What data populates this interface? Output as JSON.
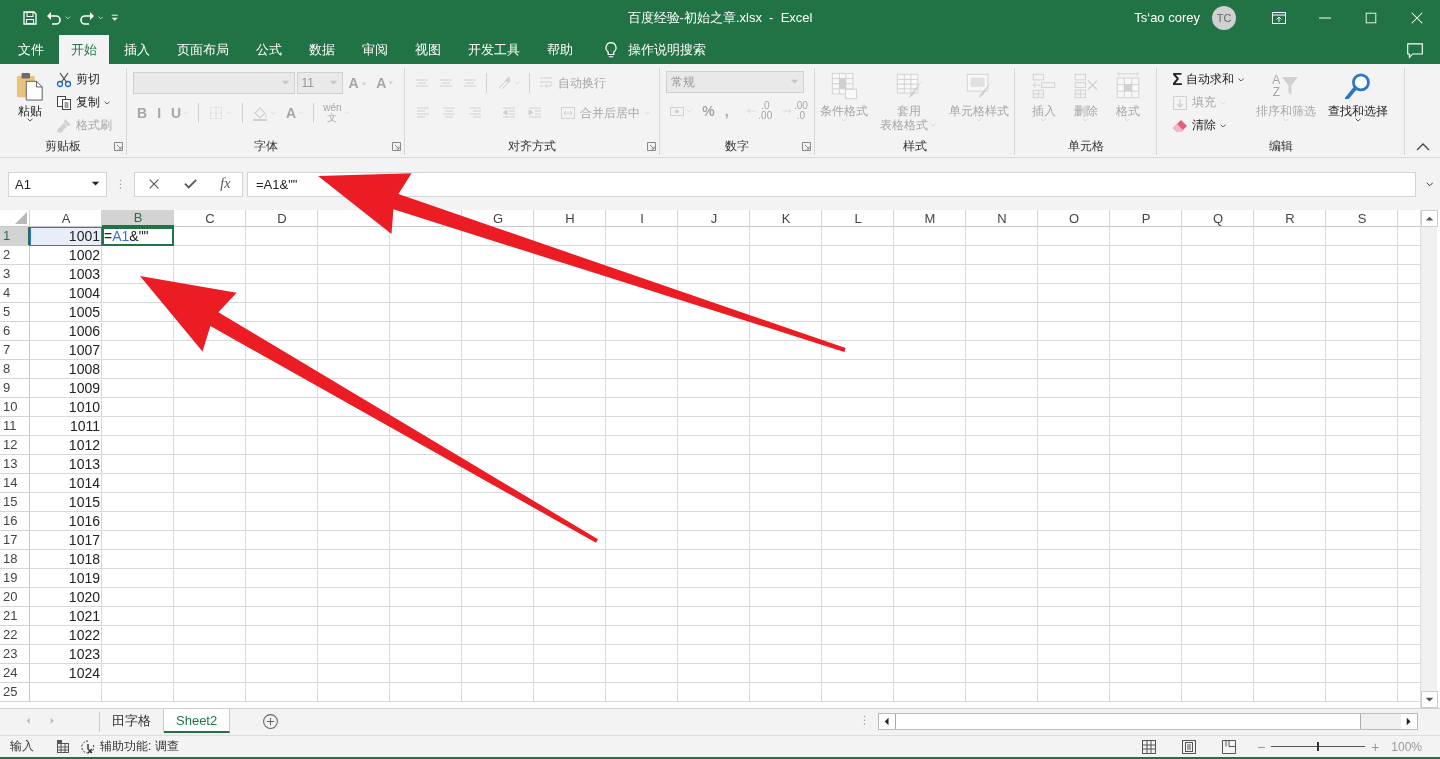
{
  "title_bar": {
    "title": "百度经验-初始之章.xlsx  -  Excel",
    "user": "Ts‘ao corey",
    "avatar": "TC"
  },
  "menu_tabs": [
    {
      "label": "文件",
      "selected": false
    },
    {
      "label": "开始",
      "selected": true
    },
    {
      "label": "插入",
      "selected": false
    },
    {
      "label": "页面布局",
      "selected": false
    },
    {
      "label": "公式",
      "selected": false
    },
    {
      "label": "数据",
      "selected": false
    },
    {
      "label": "审阅",
      "selected": false
    },
    {
      "label": "视图",
      "selected": false
    },
    {
      "label": "开发工具",
      "selected": false
    },
    {
      "label": "帮助",
      "selected": false
    }
  ],
  "tell_me": "操作说明搜索",
  "ribbon": {
    "groups": [
      {
        "label": "剪贴板",
        "launcher": true,
        "kind": "stacks",
        "stacks": [
          [
            {
              "kind": "large",
              "label": "粘贴",
              "dropdown": true,
              "disabled": false
            }
          ],
          [
            {
              "kind": "small",
              "label": "剪切",
              "disabled": false
            },
            {
              "kind": "small",
              "label": "复制",
              "dropdown": true,
              "disabled": false
            },
            {
              "kind": "small",
              "label": "格式刷",
              "disabled": true
            }
          ]
        ]
      },
      {
        "label": "字体",
        "launcher": true,
        "kind": "tiers",
        "tiers": [
          [
            {
              "kind": "field",
              "disabled": true
            },
            {
              "kind": "field",
              "value": "11",
              "disabled": true
            },
            {
              "kind": "tool",
              "glyph": "A",
              "disabled": true
            },
            {
              "kind": "tool",
              "glyph": "A",
              "disabled": true
            }
          ],
          [
            {
              "kind": "tool",
              "glyph": "B",
              "disabled": true
            },
            {
              "kind": "tool",
              "glyph": "I",
              "disabled": true
            },
            {
              "kind": "tool",
              "glyph": "U",
              "dropdown": true,
              "disabled": true
            },
            {
              "kind": "sep"
            },
            {
              "kind": "tool",
              "dropdown": true,
              "disabled": true
            },
            {
              "kind": "sep"
            },
            {
              "kind": "tool",
              "dropdown": true,
              "disabled": true
            },
            {
              "kind": "tool",
              "glyph": "A",
              "dropdown": true,
              "disabled": true
            },
            {
              "kind": "sep"
            },
            {
              "kind": "tool",
              "glyph": "wén",
              "glyph_sub": "文",
              "dropdown": true,
              "disabled": true
            }
          ]
        ]
      },
      {
        "label": "对齐方式",
        "launcher": true,
        "kind": "tiers",
        "tiers": [
          [
            {
              "kind": "tool",
              "disabled": true
            },
            {
              "kind": "tool",
              "disabled": true
            },
            {
              "kind": "tool",
              "disabled": true
            },
            {
              "kind": "sep"
            },
            {
              "kind": "tool",
              "dropdown": true,
              "disabled": true
            },
            {
              "kind": "sep"
            },
            {
              "kind": "small",
              "label": "自动换行",
              "disabled": true
            }
          ],
          [
            {
              "kind": "tool",
              "disabled": true
            },
            {
              "kind": "tool",
              "disabled": true
            },
            {
              "kind": "tool",
              "disabled": true
            },
            {
              "kind": "sep"
            },
            {
              "kind": "tool",
              "disabled": true
            },
            {
              "kind": "tool",
              "disabled": true
            },
            {
              "kind": "sep"
            },
            {
              "kind": "small",
              "label": "合并后居中",
              "dropdown": true,
              "disabled": true
            }
          ]
        ]
      },
      {
        "label": "数字",
        "launcher": true,
        "kind": "tiers",
        "tiers": [
          [
            {
              "kind": "field",
              "value": "常规",
              "disabled": true
            }
          ],
          [
            {
              "kind": "tool",
              "dropdown": true,
              "disabled": true
            },
            {
              "kind": "tool",
              "glyph": "%",
              "disabled": true
            },
            {
              "kind": "tool",
              "glyph": ",",
              "disabled": true
            },
            {
              "kind": "sep"
            },
            {
              "kind": "tool",
              "glyph": ".0",
              "glyph_sub": ".00",
              "disabled": true
            },
            {
              "kind": "tool",
              "glyph": ".00",
              "glyph_sub": ".0",
              "disabled": true
            }
          ]
        ]
      },
      {
        "label": "样式",
        "kind": "stacks",
        "stacks": [
          [
            {
              "kind": "large",
              "label": "条件格式",
              "dropdown": true,
              "disabled": true
            }
          ],
          [
            {
              "kind": "large",
              "label": "套用",
              "label_2": "表格格式",
              "dropdown": true,
              "disabled": true
            }
          ],
          [
            {
              "kind": "large",
              "label": "单元格样式",
              "dropdown": true,
              "disabled": true
            }
          ]
        ]
      },
      {
        "label": "单元格",
        "kind": "stacks",
        "stacks": [
          [
            {
              "kind": "large",
              "label": "插入",
              "dropdown": true,
              "disabled": true
            }
          ],
          [
            {
              "kind": "large",
              "label": "删除",
              "dropdown": true,
              "disabled": true
            }
          ],
          [
            {
              "kind": "large",
              "label": "格式",
              "dropdown": true,
              "disabled": true
            }
          ]
        ]
      },
      {
        "label": "编辑",
        "kind": "stacks",
        "stacks": [
          [
            {
              "kind": "small",
              "glyph": "Σ",
              "label": "自动求和",
              "dropdown": true,
              "disabled": false
            },
            {
              "kind": "small",
              "label": "填充",
              "dropdown": true,
              "disabled": true
            },
            {
              "kind": "small",
              "label": "清除",
              "dropdown": true,
              "disabled": false
            }
          ],
          [
            {
              "kind": "large",
              "glyph": "A",
              "glyph_sub": "Z",
              "label": "排序和筛选",
              "dropdown": true,
              "disabled": true
            }
          ],
          [
            {
              "kind": "large",
              "label": "查找和选择",
              "dropdown": true,
              "disabled": false
            }
          ]
        ]
      }
    ]
  },
  "formula_bar": {
    "name_box": "A1",
    "fx": "fx",
    "formula": "=A1&\"\""
  },
  "sheet": {
    "columns": [
      {
        "label": "A",
        "selected": false
      },
      {
        "label": "B",
        "selected": true
      },
      {
        "label": "C",
        "selected": false
      },
      {
        "label": "D",
        "selected": false
      },
      {
        "selected": false
      },
      {
        "selected": false
      },
      {
        "label": "G",
        "selected": false
      },
      {
        "label": "H",
        "selected": false
      },
      {
        "label": "I",
        "selected": false
      },
      {
        "label": "J",
        "selected": false
      },
      {
        "label": "K",
        "selected": false
      },
      {
        "label": "L",
        "selected": false
      },
      {
        "label": "M",
        "selected": false
      },
      {
        "label": "N",
        "selected": false
      },
      {
        "label": "O",
        "selected": false
      },
      {
        "label": "P",
        "selected": false
      },
      {
        "label": "Q",
        "selected": false
      },
      {
        "label": "R",
        "selected": false
      },
      {
        "label": "S",
        "selected": false
      }
    ],
    "rows": [
      {
        "label": "1",
        "selected": true,
        "cells": [
          {
            "kind": "number",
            "value": "1001",
            "referenced": true,
            "active": false
          },
          {
            "kind": "formula",
            "parts": [
              {
                "text": "=",
                "ref": false
              },
              {
                "text": "A1",
                "ref": true
              },
              {
                "text": "&\"\"",
                "ref": false
              }
            ],
            "referenced": false,
            "active": true
          }
        ]
      },
      {
        "label": "2",
        "selected": false,
        "cells": [
          {
            "kind": "number",
            "value": "1002",
            "referenced": false,
            "active": false
          }
        ]
      },
      {
        "label": "3",
        "selected": false,
        "cells": [
          {
            "kind": "number",
            "value": "1003",
            "referenced": false,
            "active": false
          }
        ]
      },
      {
        "label": "4",
        "selected": false,
        "cells": [
          {
            "kind": "number",
            "value": "1004",
            "referenced": false,
            "active": false
          }
        ]
      },
      {
        "label": "5",
        "selected": false,
        "cells": [
          {
            "kind": "number",
            "value": "1005",
            "referenced": false,
            "active": false
          }
        ]
      },
      {
        "label": "6",
        "selected": false,
        "cells": [
          {
            "kind": "number",
            "value": "1006",
            "referenced": false,
            "active": false
          }
        ]
      },
      {
        "label": "7",
        "selected": false,
        "cells": [
          {
            "kind": "number",
            "value": "1007",
            "referenced": false,
            "active": false
          }
        ]
      },
      {
        "label": "8",
        "selected": false,
        "cells": [
          {
            "kind": "number",
            "value": "1008",
            "referenced": false,
            "active": false
          }
        ]
      },
      {
        "label": "9",
        "selected": false,
        "cells": [
          {
            "kind": "number",
            "value": "1009",
            "referenced": false,
            "active": false
          }
        ]
      },
      {
        "label": "10",
        "selected": false,
        "cells": [
          {
            "kind": "number",
            "value": "1010",
            "referenced": false,
            "active": false
          }
        ]
      },
      {
        "label": "11",
        "selected": false,
        "cells": [
          {
            "kind": "number",
            "value": "1011",
            "referenced": false,
            "active": false
          }
        ]
      },
      {
        "label": "12",
        "selected": false,
        "cells": [
          {
            "kind": "number",
            "value": "1012",
            "referenced": false,
            "active": false
          }
        ]
      },
      {
        "label": "13",
        "selected": false,
        "cells": [
          {
            "kind": "number",
            "value": "1013",
            "referenced": false,
            "active": false
          }
        ]
      },
      {
        "label": "14",
        "selected": false,
        "cells": [
          {
            "kind": "number",
            "value": "1014",
            "referenced": false,
            "active": false
          }
        ]
      },
      {
        "label": "15",
        "selected": false,
        "cells": [
          {
            "kind": "number",
            "value": "1015",
            "referenced": false,
            "active": false
          }
        ]
      },
      {
        "label": "16",
        "selected": false,
        "cells": [
          {
            "kind": "number",
            "value": "1016",
            "referenced": false,
            "active": false
          }
        ]
      },
      {
        "label": "17",
        "selected": false,
        "cells": [
          {
            "kind": "number",
            "value": "1017",
            "referenced": false,
            "active": false
          }
        ]
      },
      {
        "label": "18",
        "selected": false,
        "cells": [
          {
            "kind": "number",
            "value": "1018",
            "referenced": false,
            "active": false
          }
        ]
      },
      {
        "label": "19",
        "selected": false,
        "cells": [
          {
            "kind": "number",
            "value": "1019",
            "referenced": false,
            "active": false
          }
        ]
      },
      {
        "label": "20",
        "selected": false,
        "cells": [
          {
            "kind": "number",
            "value": "1020",
            "referenced": false,
            "active": false
          }
        ]
      },
      {
        "label": "21",
        "selected": false,
        "cells": [
          {
            "kind": "number",
            "value": "1021",
            "referenced": false,
            "active": false
          }
        ]
      },
      {
        "label": "22",
        "selected": false,
        "cells": [
          {
            "kind": "number",
            "value": "1022",
            "referenced": false,
            "active": false
          }
        ]
      },
      {
        "label": "23",
        "selected": false,
        "cells": [
          {
            "kind": "number",
            "value": "1023",
            "referenced": false,
            "active": false
          }
        ]
      },
      {
        "label": "24",
        "selected": false,
        "cells": [
          {
            "kind": "number",
            "value": "1024",
            "referenced": false,
            "active": false
          }
        ]
      },
      {
        "label": "25",
        "selected": false
      }
    ]
  },
  "sheet_tabs": [
    {
      "label": "田字格",
      "selected": false
    },
    {
      "label": "Sheet2",
      "selected": true
    }
  ],
  "status_bar": {
    "mode": "输入",
    "accessibility": "辅助功能: 调查",
    "zoom": {
      "minus": "−",
      "plus": "+",
      "level": 0.5,
      "reading": "100%"
    }
  },
  "annotations": [
    {
      "kind": "arrow"
    },
    {
      "kind": "arrow"
    }
  ]
}
